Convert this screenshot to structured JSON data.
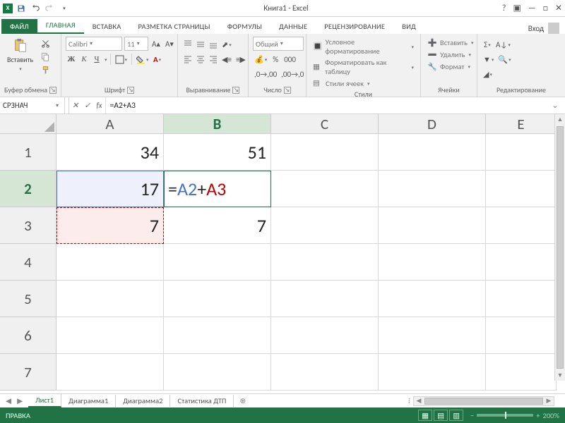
{
  "titlebar": {
    "app": "X",
    "title": "Книга1 - Excel"
  },
  "ribbon": {
    "tabs": {
      "file": "ФАЙЛ",
      "home": "ГЛАВНАЯ",
      "insert": "ВСТАВКА",
      "layout": "РАЗМЕТКА СТРАНИЦЫ",
      "formulas": "ФОРМУЛЫ",
      "data": "ДАННЫЕ",
      "review": "РЕЦЕНЗИРОВАНИЕ",
      "view": "ВИД"
    },
    "signin": "Вход",
    "groups": {
      "clipboard": {
        "label": "Буфер обмена",
        "paste": "Вставить"
      },
      "font": {
        "label": "Шрифт",
        "family": "Calibri",
        "size": "11",
        "bold": "Ж",
        "italic": "К",
        "underline": "Ч"
      },
      "alignment": {
        "label": "Выравнивание"
      },
      "number": {
        "label": "Число",
        "format": "Общий"
      },
      "styles": {
        "label": "Стили",
        "conditional": "Условное форматирование",
        "astable": "Форматировать как таблицу",
        "cellstyles": "Стили ячеек"
      },
      "cells": {
        "label": "Ячейки",
        "insert": "Вставить",
        "delete": "Удалить",
        "format": "Формат"
      },
      "editing": {
        "label": "Редактирование"
      }
    }
  },
  "formula_bar": {
    "namebox": "СРЗНАЧ",
    "formula": "=A2+A3"
  },
  "grid": {
    "cols": [
      "A",
      "B",
      "C",
      "D",
      "E"
    ],
    "rows": [
      "1",
      "2",
      "3",
      "4",
      "5",
      "6",
      "7"
    ],
    "a1": "34",
    "a2": "17",
    "a3": "7",
    "b1": "51",
    "b2_eq": "=",
    "b2_r1": "A2",
    "b2_plus": "+",
    "b2_r2": "A3",
    "b3": "7"
  },
  "sheets": {
    "s1": "Лист1",
    "s2": "Диаграмма1",
    "s3": "Диаграмма2",
    "s4": "Статистика ДТП"
  },
  "status": {
    "mode": "ПРАВКА",
    "zoom": "200%"
  }
}
